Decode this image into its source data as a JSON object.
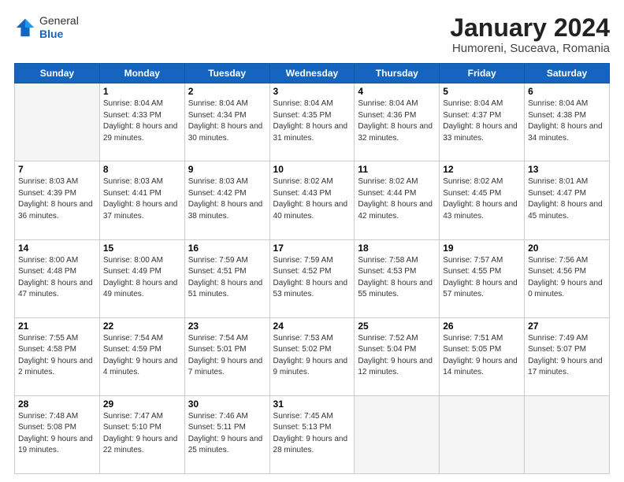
{
  "header": {
    "logo_general": "General",
    "logo_blue": "Blue",
    "title": "January 2024",
    "subtitle": "Humoreni, Suceava, Romania"
  },
  "days_of_week": [
    "Sunday",
    "Monday",
    "Tuesday",
    "Wednesday",
    "Thursday",
    "Friday",
    "Saturday"
  ],
  "weeks": [
    [
      {
        "day": "",
        "empty": true
      },
      {
        "day": "1",
        "sunrise": "Sunrise: 8:04 AM",
        "sunset": "Sunset: 4:33 PM",
        "daylight": "Daylight: 8 hours and 29 minutes."
      },
      {
        "day": "2",
        "sunrise": "Sunrise: 8:04 AM",
        "sunset": "Sunset: 4:34 PM",
        "daylight": "Daylight: 8 hours and 30 minutes."
      },
      {
        "day": "3",
        "sunrise": "Sunrise: 8:04 AM",
        "sunset": "Sunset: 4:35 PM",
        "daylight": "Daylight: 8 hours and 31 minutes."
      },
      {
        "day": "4",
        "sunrise": "Sunrise: 8:04 AM",
        "sunset": "Sunset: 4:36 PM",
        "daylight": "Daylight: 8 hours and 32 minutes."
      },
      {
        "day": "5",
        "sunrise": "Sunrise: 8:04 AM",
        "sunset": "Sunset: 4:37 PM",
        "daylight": "Daylight: 8 hours and 33 minutes."
      },
      {
        "day": "6",
        "sunrise": "Sunrise: 8:04 AM",
        "sunset": "Sunset: 4:38 PM",
        "daylight": "Daylight: 8 hours and 34 minutes."
      }
    ],
    [
      {
        "day": "7",
        "sunrise": "Sunrise: 8:03 AM",
        "sunset": "Sunset: 4:39 PM",
        "daylight": "Daylight: 8 hours and 36 minutes."
      },
      {
        "day": "8",
        "sunrise": "Sunrise: 8:03 AM",
        "sunset": "Sunset: 4:41 PM",
        "daylight": "Daylight: 8 hours and 37 minutes."
      },
      {
        "day": "9",
        "sunrise": "Sunrise: 8:03 AM",
        "sunset": "Sunset: 4:42 PM",
        "daylight": "Daylight: 8 hours and 38 minutes."
      },
      {
        "day": "10",
        "sunrise": "Sunrise: 8:02 AM",
        "sunset": "Sunset: 4:43 PM",
        "daylight": "Daylight: 8 hours and 40 minutes."
      },
      {
        "day": "11",
        "sunrise": "Sunrise: 8:02 AM",
        "sunset": "Sunset: 4:44 PM",
        "daylight": "Daylight: 8 hours and 42 minutes."
      },
      {
        "day": "12",
        "sunrise": "Sunrise: 8:02 AM",
        "sunset": "Sunset: 4:45 PM",
        "daylight": "Daylight: 8 hours and 43 minutes."
      },
      {
        "day": "13",
        "sunrise": "Sunrise: 8:01 AM",
        "sunset": "Sunset: 4:47 PM",
        "daylight": "Daylight: 8 hours and 45 minutes."
      }
    ],
    [
      {
        "day": "14",
        "sunrise": "Sunrise: 8:00 AM",
        "sunset": "Sunset: 4:48 PM",
        "daylight": "Daylight: 8 hours and 47 minutes."
      },
      {
        "day": "15",
        "sunrise": "Sunrise: 8:00 AM",
        "sunset": "Sunset: 4:49 PM",
        "daylight": "Daylight: 8 hours and 49 minutes."
      },
      {
        "day": "16",
        "sunrise": "Sunrise: 7:59 AM",
        "sunset": "Sunset: 4:51 PM",
        "daylight": "Daylight: 8 hours and 51 minutes."
      },
      {
        "day": "17",
        "sunrise": "Sunrise: 7:59 AM",
        "sunset": "Sunset: 4:52 PM",
        "daylight": "Daylight: 8 hours and 53 minutes."
      },
      {
        "day": "18",
        "sunrise": "Sunrise: 7:58 AM",
        "sunset": "Sunset: 4:53 PM",
        "daylight": "Daylight: 8 hours and 55 minutes."
      },
      {
        "day": "19",
        "sunrise": "Sunrise: 7:57 AM",
        "sunset": "Sunset: 4:55 PM",
        "daylight": "Daylight: 8 hours and 57 minutes."
      },
      {
        "day": "20",
        "sunrise": "Sunrise: 7:56 AM",
        "sunset": "Sunset: 4:56 PM",
        "daylight": "Daylight: 9 hours and 0 minutes."
      }
    ],
    [
      {
        "day": "21",
        "sunrise": "Sunrise: 7:55 AM",
        "sunset": "Sunset: 4:58 PM",
        "daylight": "Daylight: 9 hours and 2 minutes."
      },
      {
        "day": "22",
        "sunrise": "Sunrise: 7:54 AM",
        "sunset": "Sunset: 4:59 PM",
        "daylight": "Daylight: 9 hours and 4 minutes."
      },
      {
        "day": "23",
        "sunrise": "Sunrise: 7:54 AM",
        "sunset": "Sunset: 5:01 PM",
        "daylight": "Daylight: 9 hours and 7 minutes."
      },
      {
        "day": "24",
        "sunrise": "Sunrise: 7:53 AM",
        "sunset": "Sunset: 5:02 PM",
        "daylight": "Daylight: 9 hours and 9 minutes."
      },
      {
        "day": "25",
        "sunrise": "Sunrise: 7:52 AM",
        "sunset": "Sunset: 5:04 PM",
        "daylight": "Daylight: 9 hours and 12 minutes."
      },
      {
        "day": "26",
        "sunrise": "Sunrise: 7:51 AM",
        "sunset": "Sunset: 5:05 PM",
        "daylight": "Daylight: 9 hours and 14 minutes."
      },
      {
        "day": "27",
        "sunrise": "Sunrise: 7:49 AM",
        "sunset": "Sunset: 5:07 PM",
        "daylight": "Daylight: 9 hours and 17 minutes."
      }
    ],
    [
      {
        "day": "28",
        "sunrise": "Sunrise: 7:48 AM",
        "sunset": "Sunset: 5:08 PM",
        "daylight": "Daylight: 9 hours and 19 minutes."
      },
      {
        "day": "29",
        "sunrise": "Sunrise: 7:47 AM",
        "sunset": "Sunset: 5:10 PM",
        "daylight": "Daylight: 9 hours and 22 minutes."
      },
      {
        "day": "30",
        "sunrise": "Sunrise: 7:46 AM",
        "sunset": "Sunset: 5:11 PM",
        "daylight": "Daylight: 9 hours and 25 minutes."
      },
      {
        "day": "31",
        "sunrise": "Sunrise: 7:45 AM",
        "sunset": "Sunset: 5:13 PM",
        "daylight": "Daylight: 9 hours and 28 minutes."
      },
      {
        "day": "",
        "empty": true
      },
      {
        "day": "",
        "empty": true
      },
      {
        "day": "",
        "empty": true
      }
    ]
  ]
}
